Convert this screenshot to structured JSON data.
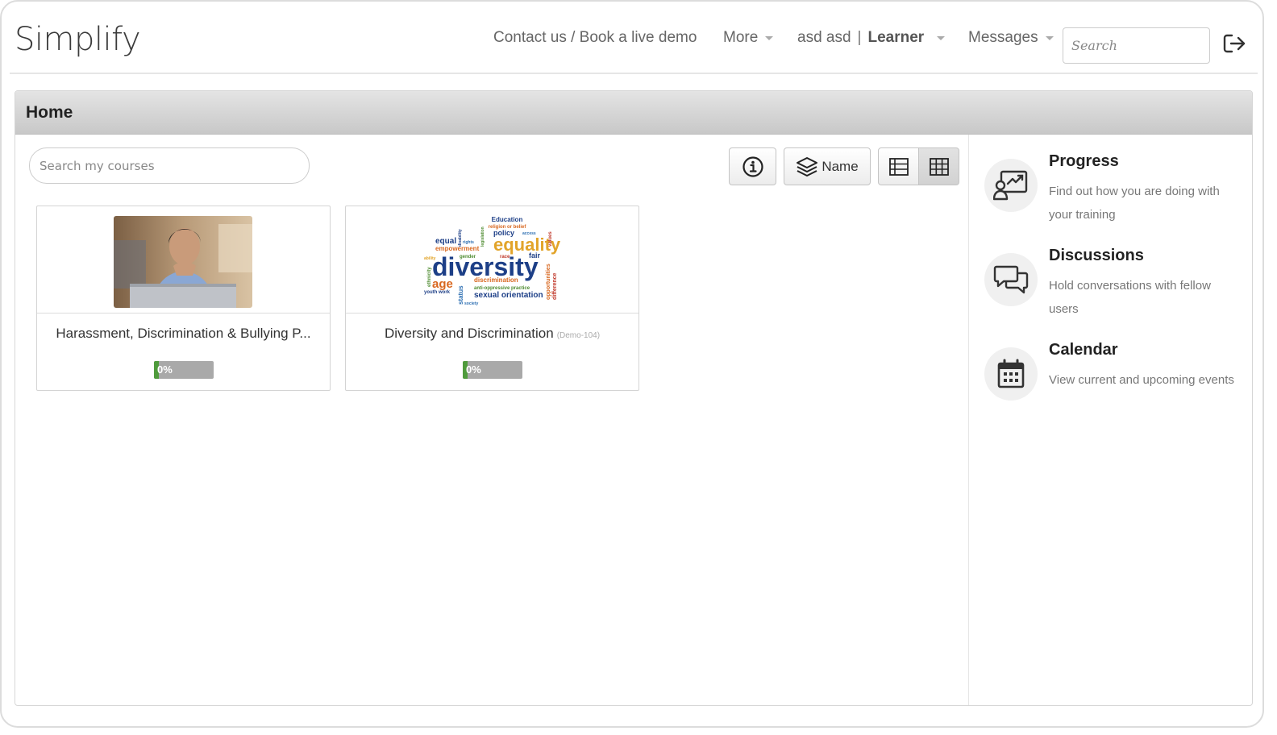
{
  "header": {
    "brand": "Simplify",
    "contact_link": "Contact us / Book a live demo",
    "more_menu": "More",
    "user_name": "asd asd",
    "user_separator": "|",
    "user_role": "Learner",
    "messages_menu": "Messages",
    "search_placeholder": "Search"
  },
  "panel": {
    "title": "Home",
    "course_search_placeholder": "Search my courses",
    "sort_label": "Name"
  },
  "courses": [
    {
      "title": "Harassment, Discrimination & Bullying P...",
      "code": "",
      "progress_label": "0%",
      "progress": 0,
      "image": "woman-thinking-at-laptop-photo"
    },
    {
      "title": "Diversity and Discrimination",
      "code": "(Demo-104)",
      "progress_label": "0%",
      "progress": 0,
      "image": "diversity-word-cloud"
    }
  ],
  "word_cloud": {
    "words": [
      "Education",
      "religion or belief",
      "equal",
      "rights",
      "policy",
      "access",
      "equality",
      "empowerment",
      "gender",
      "race",
      "fair",
      "diversity",
      "age",
      "discrimination",
      "anti-oppressive practice",
      "sexual orientation",
      "youth work",
      "society",
      "status",
      "ethnicity",
      "opportunities",
      "difference",
      "values",
      "ability",
      "legislation",
      "disability"
    ],
    "colors": [
      "#d8671f",
      "#2d6fb2",
      "#1d3f87",
      "#e2a42a",
      "#4d8b2f",
      "#c0392b"
    ]
  },
  "sidebar": [
    {
      "title": "Progress",
      "description": "Find out how you are doing with your training",
      "icon": "progress-chart-icon"
    },
    {
      "title": "Discussions",
      "description": "Hold conversations with fellow users",
      "icon": "chat-bubbles-icon"
    },
    {
      "title": "Calendar",
      "description": "View current and upcoming events",
      "icon": "calendar-icon"
    }
  ]
}
